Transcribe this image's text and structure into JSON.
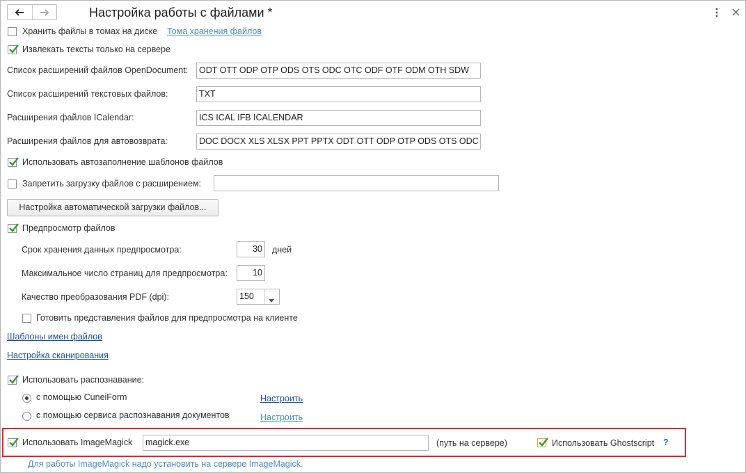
{
  "title": "Настройка работы с файлами *",
  "store_in_volumes": {
    "label": "Хранить файлы в томах на диске",
    "checked": false,
    "link": "Тома хранения файлов"
  },
  "extract_text_server": {
    "label": "Извлекать тексты только на сервере",
    "checked": true
  },
  "od_ext": {
    "label": "Список расширений файлов OpenDocument:",
    "value": "ODT OTT ODP OTP ODS OTS ODC OTC ODF OTF ODM OTH SDW"
  },
  "text_ext": {
    "label": "Список расширений текстовых файлов:",
    "value": "TXT"
  },
  "ical_ext": {
    "label": "Расширения файлов ICalendar:",
    "value": "ICS ICAL IFB ICALENDAR"
  },
  "autoreturn_ext": {
    "label": "Расширения файлов для автовозврата:",
    "value": "DOC DOCX XLS XLSX PPT PPTX ODT OTT ODP OTP ODS OTS ODC"
  },
  "autofill_templates": {
    "label": "Использовать автозаполнение шаблонов файлов",
    "checked": true
  },
  "forbid_upload": {
    "label": "Запретить загрузку файлов с расширением:",
    "checked": false,
    "value": ""
  },
  "auto_upload_button": "Настройка автоматической загрузки файлов...",
  "preview": {
    "label": "Предпросмотр файлов",
    "checked": true,
    "retention_label": "Срок хранения данных предпросмотра:",
    "retention_value": "30",
    "retention_unit": "дней",
    "max_pages_label": "Максимальное число страниц для предпросмотра:",
    "max_pages_value": "10",
    "pdf_quality_label": "Качество преобразования PDF (dpi):",
    "pdf_quality_value": "150",
    "client_label": "Готовить представления файлов для предпросмотра на клиенте",
    "client_checked": false
  },
  "links": {
    "name_templates": "Шаблоны имен файлов",
    "scan_settings": "Настройка сканирования"
  },
  "recognition": {
    "label": "Использовать распознавание:",
    "checked": true,
    "opt1": "с помощью CuneiForm",
    "opt1_link": "Настроить",
    "opt2": "с помощью сервиса распознавания документов",
    "opt2_link": "Настроить",
    "selected": "opt1"
  },
  "imagemagick": {
    "label": "Использовать ImageMagick",
    "checked": true,
    "value": "magick.exe",
    "path_note": "(путь на сервере)"
  },
  "ghostscript": {
    "label": "Использовать Ghostscript",
    "checked": true,
    "help": "?"
  },
  "footer_note": "Для работы ImageMagick надо установить на сервере ImageMagick.",
  "colors": {
    "accent_link": "#4a90c2",
    "highlight_border": "#e2262b",
    "check": "#2e9b3a"
  }
}
